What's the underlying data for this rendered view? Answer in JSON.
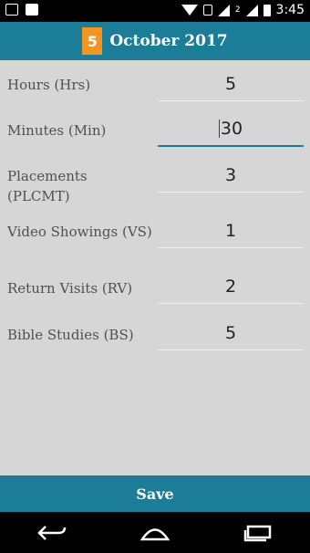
{
  "status_bar": {
    "small_left": "2",
    "time": "3:45"
  },
  "header": {
    "day": "5",
    "title": "October 2017"
  },
  "form": {
    "rows": [
      {
        "label": "Hours (Hrs)",
        "value": "5"
      },
      {
        "label": "Minutes (Min)",
        "value": "30"
      },
      {
        "label": "Placements (PLCMT)",
        "value": "3"
      },
      {
        "label": "Video Showings (VS)",
        "value": "1"
      },
      {
        "label": "Return Visits (RV)",
        "value": "2"
      },
      {
        "label": "Bible Studies (BS)",
        "value": "5"
      }
    ]
  },
  "actions": {
    "save_label": "Save"
  },
  "colors": {
    "primary": "#1b7d97",
    "accent": "#f29521",
    "background": "#d6d6d6"
  }
}
